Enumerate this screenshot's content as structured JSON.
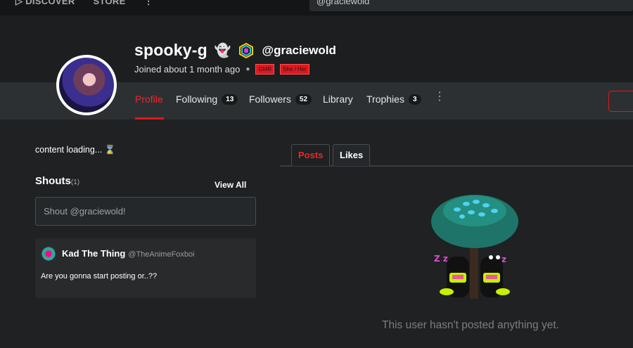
{
  "topnav": {
    "discover": "▷ DISCOVER",
    "store": "STORE",
    "more": "⋮"
  },
  "search": {
    "value": "@graciewold"
  },
  "profile": {
    "name": "spooky-g",
    "name_emoji": "👻",
    "handle": "@graciewold",
    "joined": "Joined about 1 month ago",
    "tags": [
      "GMR",
      "She / Her"
    ]
  },
  "tabs": [
    {
      "label": "Profile"
    },
    {
      "label": "Following",
      "count": "13"
    },
    {
      "label": "Followers",
      "count": "52"
    },
    {
      "label": "Library"
    },
    {
      "label": "Trophies",
      "count": "3"
    }
  ],
  "more_label": "⋮",
  "sidebar": {
    "loading": "content loading... ⌛",
    "shouts_title": "Shouts",
    "shouts_count": "(1)",
    "view_all": "View All",
    "shout_placeholder": "Shout @graciewold!"
  },
  "shout": {
    "author": "Kad The Thing",
    "handle": "@TheAnimeFoxboi",
    "text": "Are you gonna start posting or..??"
  },
  "post_tabs": {
    "posts": "Posts",
    "likes": "Likes"
  },
  "empty": {
    "message": "This user hasn't posted anything yet.",
    "zz_left": "Z z",
    "zz_right": "z"
  },
  "colors": {
    "accent": "#e1171f",
    "background": "#1f2122",
    "tabbar": "#2d3032"
  },
  "icons": {
    "ghost": "ghost-emoji",
    "verified": "hexagon-badge-icon",
    "hourglass": "hourglass-icon"
  }
}
